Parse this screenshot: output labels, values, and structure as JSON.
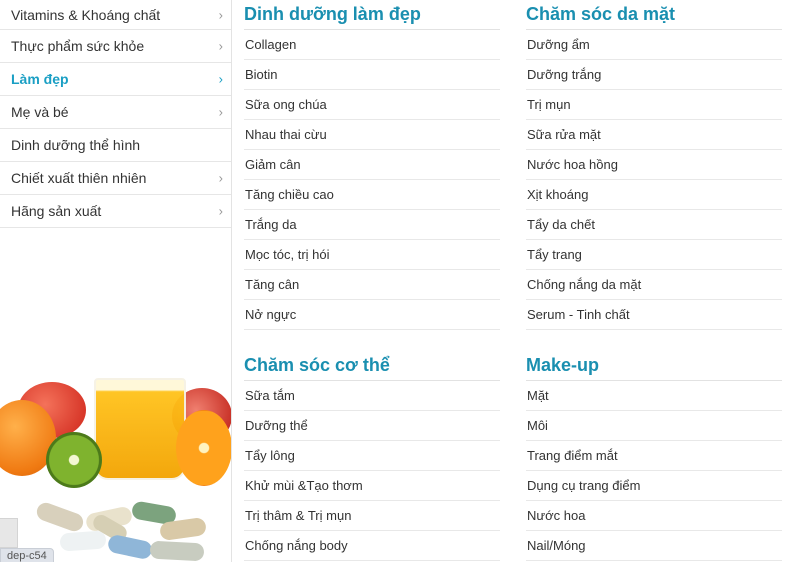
{
  "sidebar": {
    "items": [
      {
        "label": "Vitamins & Khoáng chất",
        "has_arrow": true,
        "active": false
      },
      {
        "label": "Thực phẩm sức khỏe",
        "has_arrow": true,
        "active": false
      },
      {
        "label": "Làm đẹp",
        "has_arrow": true,
        "active": true
      },
      {
        "label": "Mẹ và bé",
        "has_arrow": true,
        "active": false
      },
      {
        "label": "Dinh dưỡng thể hình",
        "has_arrow": false,
        "active": false
      },
      {
        "label": "Chiết xuất thiên nhiên",
        "has_arrow": true,
        "active": false
      },
      {
        "label": "Hãng sản xuất",
        "has_arrow": true,
        "active": false
      }
    ],
    "arrow_glyph": "›",
    "status_tag": "dep-c54"
  },
  "sections": {
    "nutrition_beauty": {
      "title": "Dinh dưỡng làm đẹp",
      "items": [
        "Collagen",
        "Biotin",
        "Sữa ong chúa",
        "Nhau thai cừu",
        "Giảm cân",
        "Tăng chiều cao",
        "Trắng da",
        "Mọc tóc, trị hói",
        "Tăng cân",
        "Nở ngực"
      ]
    },
    "face_care": {
      "title": "Chăm sóc da mặt",
      "items": [
        "Dưỡng ẩm",
        "Dưỡng trắng",
        "Trị mụn",
        "Sữa rửa mặt",
        "Nước hoa hồng",
        "Xịt khoáng",
        "Tẩy da chết",
        "Tẩy trang",
        "Chống nắng da mặt",
        "Serum - Tinh chất"
      ]
    },
    "body_care": {
      "title": "Chăm sóc cơ thể",
      "items": [
        "Sữa tắm",
        "Dưỡng thể",
        "Tẩy lông",
        "Khử mùi &Tạo thơm",
        "Trị thâm & Trị mụn",
        "Chống nắng body"
      ]
    },
    "makeup": {
      "title": "Make-up",
      "items": [
        "Mặt",
        "Môi",
        "Trang điểm mắt",
        "Dụng cụ trang điểm",
        "Nước hoa",
        "Nail/Móng"
      ]
    }
  },
  "colors": {
    "accent": "#1a9fc4",
    "section_title": "#1a8fb0",
    "divider": "#e6e6e6"
  },
  "icons": {
    "chevron": "chevron-right-icon"
  }
}
